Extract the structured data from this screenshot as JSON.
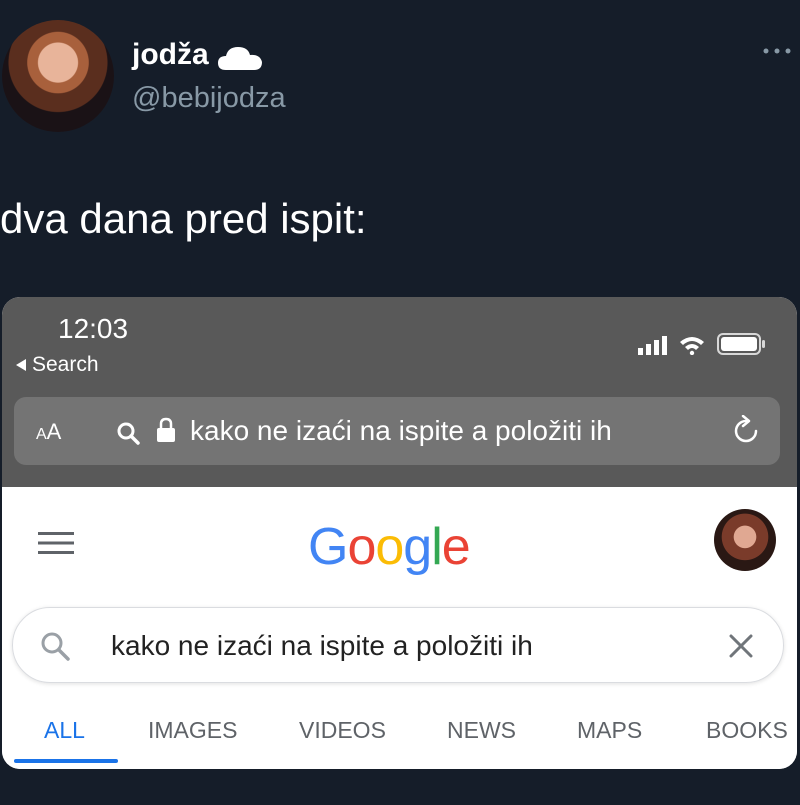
{
  "tweet": {
    "display_name": "jodža",
    "handle": "@bebijodza",
    "text": "dva dana pred ispit:"
  },
  "phone": {
    "time": "12:03",
    "back_label": "Search",
    "url_bar": {
      "aa_label_big": "A",
      "aa_label_small": "A",
      "url_text": "kako ne izaći na ispite a položiti ih"
    }
  },
  "google": {
    "logo_letters": [
      "G",
      "o",
      "o",
      "g",
      "l",
      "e"
    ],
    "logo_colors": [
      "#4285F4",
      "#EA4335",
      "#FBBC05",
      "#4285F4",
      "#34A853",
      "#EA4335"
    ],
    "search_query": "kako ne izaći na ispite a položiti ih",
    "tabs": [
      "ALL",
      "IMAGES",
      "VIDEOS",
      "NEWS",
      "MAPS",
      "BOOKS"
    ],
    "active_tab": "ALL"
  },
  "icons": [
    "cloud-icon",
    "more-icon",
    "back-arrow-icon",
    "signal-icon",
    "wifi-icon",
    "battery-icon",
    "search-icon",
    "lock-icon",
    "reload-icon",
    "menu-icon",
    "clear-icon"
  ]
}
